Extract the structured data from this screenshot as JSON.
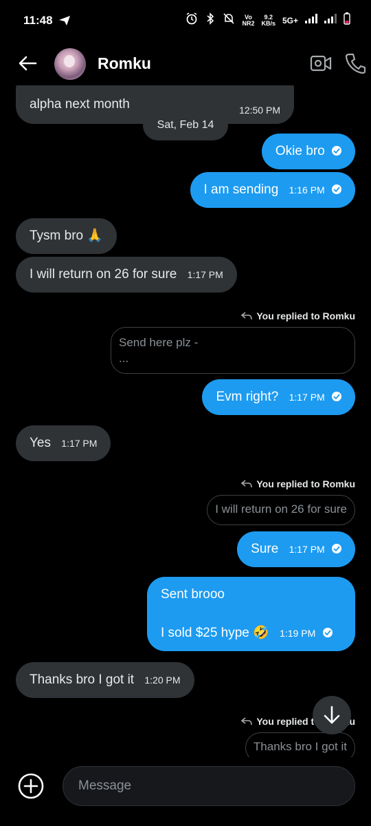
{
  "status_bar": {
    "time": "11:48",
    "speed_value": "9.2",
    "speed_unit": "KB/s",
    "vonr_top": "Vo",
    "vonr_bottom": "NR2",
    "network": "5G+"
  },
  "header": {
    "contact_name": "Romku"
  },
  "messages": {
    "m0": {
      "text": "alpha next month",
      "time": "12:50 PM"
    },
    "date_separator": "Sat, Feb 14",
    "m1": {
      "text": "Okie bro"
    },
    "m2": {
      "text": "I am sending",
      "time": "1:16 PM"
    },
    "m3": {
      "text": "Tysm bro 🙏"
    },
    "m4": {
      "text": "I will return on 26 for sure",
      "time": "1:17 PM"
    },
    "r1": {
      "label": "You replied to Romku",
      "quote_line1": "Send here plz -",
      "quote_line2": "..."
    },
    "m5": {
      "text": "Evm right?",
      "time": "1:17 PM"
    },
    "m6": {
      "text": "Yes",
      "time": "1:17 PM"
    },
    "r2": {
      "label": "You replied to Romku",
      "quote": "I will return on 26 for sure"
    },
    "m7": {
      "text": "Sure",
      "time": "1:17 PM"
    },
    "m8": {
      "line1": "Sent brooo",
      "line2": "I sold $25 hype 🤣",
      "time": "1:19 PM"
    },
    "m9": {
      "text": "Thanks bro I got it",
      "time": "1:20 PM"
    },
    "r3": {
      "label": "You replied to Romku",
      "quote": "Thanks bro I got it"
    }
  },
  "composer": {
    "placeholder": "Message"
  },
  "colors": {
    "background": "#000000",
    "incoming_bubble": "#2f3336",
    "outgoing_bubble": "#1d9bf0"
  }
}
